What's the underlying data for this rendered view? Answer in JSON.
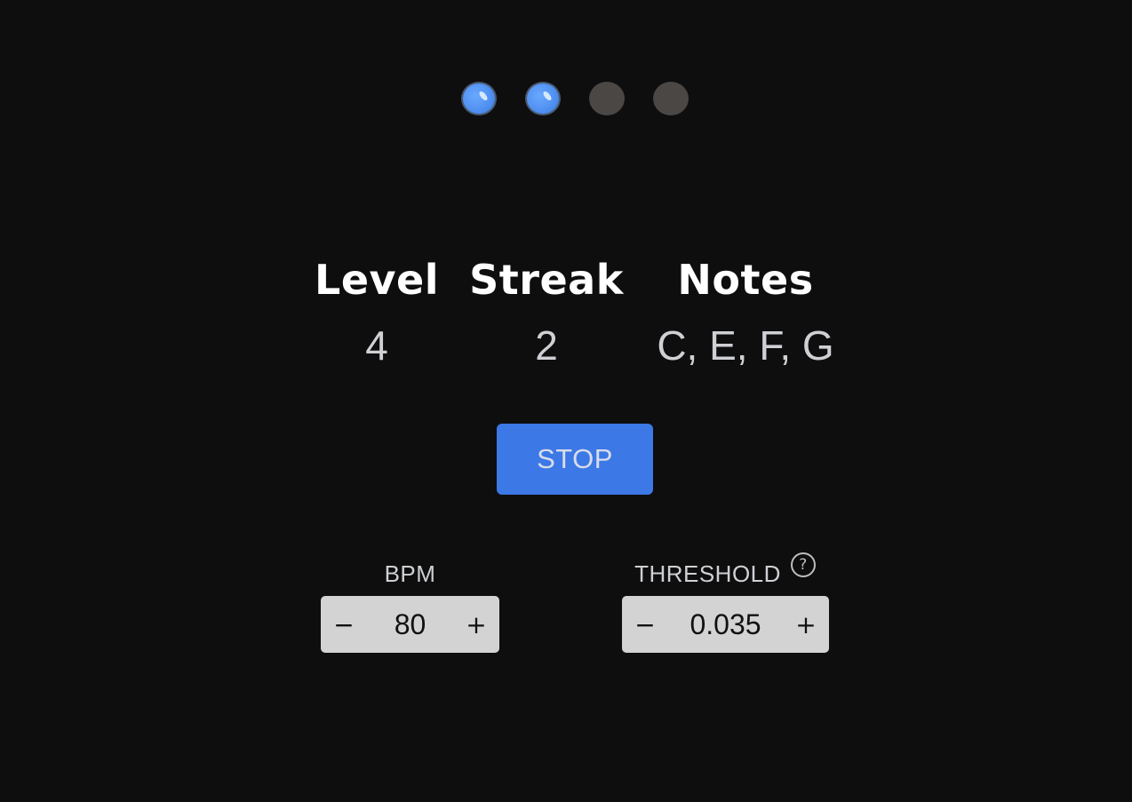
{
  "beats": [
    {
      "state": "active"
    },
    {
      "state": "active"
    },
    {
      "state": "inactive"
    },
    {
      "state": "inactive"
    }
  ],
  "stats": {
    "level": {
      "label": "Level",
      "value": "4"
    },
    "streak": {
      "label": "Streak",
      "value": "2"
    },
    "notes": {
      "label": "Notes",
      "value": "C, E, F, G"
    }
  },
  "stop_button": {
    "label": "STOP"
  },
  "controls": {
    "bpm": {
      "label": "BPM",
      "value": "80",
      "decrement": "−",
      "increment": "+"
    },
    "threshold": {
      "label": "THRESHOLD",
      "value": "0.035",
      "decrement": "−",
      "increment": "+",
      "help": "?"
    }
  },
  "colors": {
    "background": "#0e0e0f",
    "accent": "#3c78e6",
    "beat_active": "#4f8ff0",
    "beat_inactive": "#4a4744",
    "stepper_bg": "#d3d3d3"
  }
}
